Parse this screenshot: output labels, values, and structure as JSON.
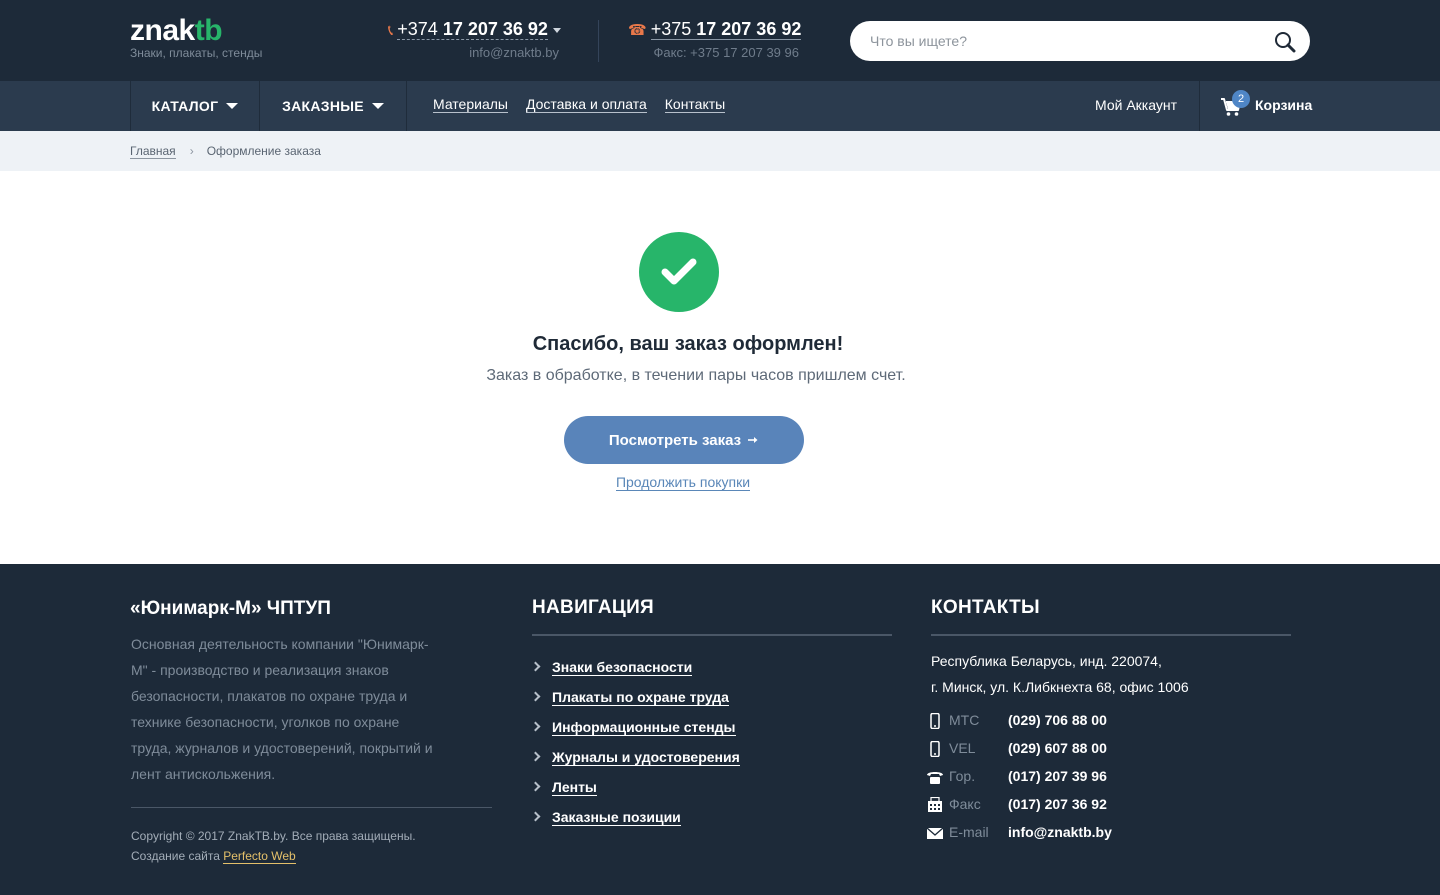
{
  "header": {
    "logo_main": "znak",
    "logo_accent": "tb",
    "tagline": "Знаки, плакаты, стенды",
    "phone1_prefix": "+374",
    "phone1_number": "17 207 36 92",
    "email": "info@znaktb.by",
    "phone2_prefix": "+375",
    "phone2_number": "17 207 36 92",
    "fax": "Факс: +375 17 207 39 96",
    "search_placeholder": "Что вы ищете?",
    "accent_color": "#27b56a"
  },
  "nav": {
    "catalog": "КАТАЛОГ",
    "custom": "ЗАКАЗНЫЕ",
    "links": [
      "Материалы",
      "Доставка и оплата",
      "Контакты"
    ],
    "account": "Мой Аккаунт",
    "cart_label": "Корзина",
    "cart_count": "2"
  },
  "breadcrumb": {
    "home": "Главная",
    "current": "Оформление заказа"
  },
  "main": {
    "title": "Спасибо, ваш заказ оформлен!",
    "subtitle": "Заказ в обработке, в течении пары часов пришлем счет.",
    "view_button": "Посмотреть заказ",
    "continue_link": "Продолжить покупки",
    "success_color": "#27b56a",
    "button_color": "#5984ba"
  },
  "footer": {
    "company": "«Юнимарк-М» ЧПТУП",
    "description": "Основная деятельность компании \"Юнимарк-М\" - производство и реализация знаков безопасности, плакатов по охране труда и технике безопасности, уголков по охране труда, журналов и удостоверений, покрытий и лент антискольжения.",
    "copyright": "Copyright © 2017 ZnakTB.by. Все права защищены.",
    "made_by_prefix": "Создание сайта",
    "made_by_link": "Perfecto Web",
    "nav_title": "НАВИГАЦИЯ",
    "nav_items": [
      "Знаки безопасности",
      "Плакаты по охране труда",
      "Информационные стенды",
      "Журналы и удостоверения",
      "Ленты",
      "Заказные позиции"
    ],
    "contacts_title": "КОНТАКТЫ",
    "address_line1": "Республика Беларусь, инд. 220074,",
    "address_line2": "г. Минск, ул. К.Либкнехта 68, офис 1006",
    "contacts": [
      {
        "icon": "mobile-icon",
        "label": "МТС",
        "value": "(029) 706 88 00"
      },
      {
        "icon": "mobile-icon",
        "label": "VEL",
        "value": "(029) 607 88 00"
      },
      {
        "icon": "phone-icon",
        "label": "Гор.",
        "value": "(017) 207 39 96"
      },
      {
        "icon": "fax-icon",
        "label": "Факс",
        "value": "(017) 207 36 92"
      },
      {
        "icon": "mail-icon",
        "label": "E-mail",
        "value": "info@znaktb.by"
      }
    ]
  }
}
